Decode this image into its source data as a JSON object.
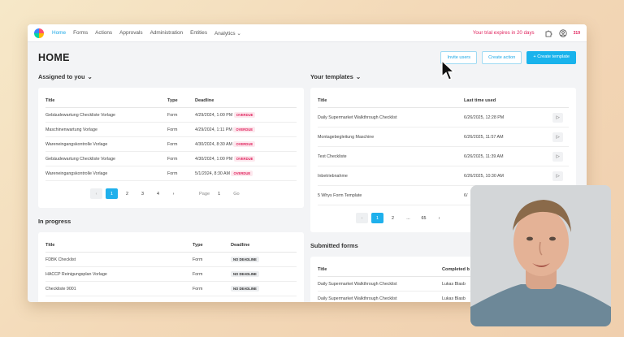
{
  "nav": {
    "items": [
      "Home",
      "Forms",
      "Actions",
      "Approvals",
      "Administration",
      "Entities",
      "Analytics"
    ],
    "trial": "Your trial expires in 20 days",
    "badge": "319"
  },
  "header": {
    "title": "HOME",
    "invite": "Invite users",
    "create_action": "Create action",
    "create_template": "+ Create template"
  },
  "assigned": {
    "title": "Assigned to you",
    "columns": [
      "Title",
      "Type",
      "Deadline"
    ],
    "rows": [
      {
        "title": "Gebäudewartung Checkliste Vorlage",
        "type": "Form",
        "deadline": "4/29/2024, 1:00 PM",
        "status": "OVERDUE"
      },
      {
        "title": "Maschinenwartung Vorlage",
        "type": "Form",
        "deadline": "4/29/2024, 1:11 PM",
        "status": "OVERDUE"
      },
      {
        "title": "Wareneingangskontrolle Vorlage",
        "type": "Form",
        "deadline": "4/30/2024, 8:30 AM",
        "status": "OVERDUE"
      },
      {
        "title": "Gebäudewartung Checkliste Vorlage",
        "type": "Form",
        "deadline": "4/30/2024, 1:00 PM",
        "status": "OVERDUE"
      },
      {
        "title": "Wareneingangskontrolle Vorlage",
        "type": "Form",
        "deadline": "5/1/2024, 8:30 AM",
        "status": "OVERDUE"
      }
    ],
    "pages": [
      "1",
      "2",
      "3",
      "4"
    ],
    "page_label": "Page",
    "page_value": "1",
    "go": "Go"
  },
  "in_progress": {
    "title": "In progress",
    "columns": [
      "Title",
      "Type",
      "Deadline"
    ],
    "rows": [
      {
        "title": "FDBK Checklist",
        "type": "Form",
        "status": "NO DEADLINE"
      },
      {
        "title": "HACCP Reinigungsplan Vorlage",
        "type": "Form",
        "status": "NO DEADLINE"
      },
      {
        "title": "Checkliste 9001",
        "type": "Form",
        "status": "NO DEADLINE"
      }
    ]
  },
  "templates": {
    "title": "Your templates",
    "columns": [
      "Title",
      "Last time used"
    ],
    "rows": [
      {
        "title": "Daily Supermarket Walkthrough Checklist",
        "used": "6/26/2025, 12:28 PM"
      },
      {
        "title": "Montagebegleitung Maschine",
        "used": "6/26/2025, 11:57 AM"
      },
      {
        "title": "Test Checkliste",
        "used": "6/26/2025, 11:39 AM"
      },
      {
        "title": "Inbetriebnahme",
        "used": "6/26/2025, 10:30 AM"
      },
      {
        "title": "5 Whys Form Template",
        "used": "6/"
      }
    ],
    "pages": [
      "1",
      "2",
      "...",
      "65"
    ]
  },
  "submitted": {
    "title": "Submitted forms",
    "columns": [
      "Title",
      "Completed b"
    ],
    "rows": [
      {
        "title": "Daily Supermarket Walkthrough Checklist",
        "by": "Lukas Blasb"
      },
      {
        "title": "Daily Supermarket Walkthrough Checklist",
        "by": "Lukas Blasb"
      }
    ]
  }
}
